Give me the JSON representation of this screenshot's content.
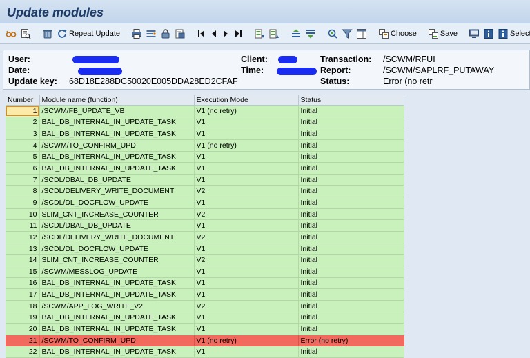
{
  "title": "Update modules",
  "toolbar": {
    "repeat_update_label": "Repeat Update",
    "choose_label": "Choose",
    "save_label": "Save",
    "selections_label": "Selections",
    "icons": [
      "glasses-icon",
      "details-icon",
      "trash-icon",
      "refresh-icon",
      "print-icon",
      "find-icon",
      "lock-icon",
      "export-icon",
      "first-page-icon",
      "previous-page-icon",
      "next-page-icon",
      "last-page-icon",
      "sort-asc-icon",
      "sort-desc-icon",
      "align-icon",
      "filter-icon",
      "sum-icon",
      "columns-icon",
      "copy-icon",
      "select-layout-icon",
      "save-layout-icon",
      "display-icon",
      "info-icon",
      "help-icon"
    ]
  },
  "header": {
    "user_label": "User:",
    "date_label": "Date:",
    "update_key_label": "Update key:",
    "update_key_value": "68D18E288DC50020E005DDA28ED2CFAF",
    "client_label": "Client:",
    "time_label": "Time:",
    "transaction_label": "Transaction:",
    "transaction_value": "/SCWM/RFUI",
    "report_label": "Report:",
    "report_value": "/SCWM/SAPLRF_PUTAWAY",
    "status_label": "Status:",
    "status_value": "Error (no retr"
  },
  "table": {
    "columns": [
      "Number",
      "Module name (function)",
      "Execution Mode",
      "Status"
    ],
    "rows": [
      {
        "number": "1",
        "module": "/SCWM/FB_UPDATE_VB",
        "mode": "V1 (no retry)",
        "status": "Initial",
        "state": "ok"
      },
      {
        "number": "2",
        "module": "BAL_DB_INTERNAL_IN_UPDATE_TASK",
        "mode": "V1",
        "status": "Initial",
        "state": "ok"
      },
      {
        "number": "3",
        "module": "BAL_DB_INTERNAL_IN_UPDATE_TASK",
        "mode": "V1",
        "status": "Initial",
        "state": "ok"
      },
      {
        "number": "4",
        "module": "/SCWM/TO_CONFIRM_UPD",
        "mode": "V1 (no retry)",
        "status": "Initial",
        "state": "ok"
      },
      {
        "number": "5",
        "module": "BAL_DB_INTERNAL_IN_UPDATE_TASK",
        "mode": "V1",
        "status": "Initial",
        "state": "ok"
      },
      {
        "number": "6",
        "module": "BAL_DB_INTERNAL_IN_UPDATE_TASK",
        "mode": "V1",
        "status": "Initial",
        "state": "ok"
      },
      {
        "number": "7",
        "module": "/SCDL/DBAL_DB_UPDATE",
        "mode": "V1",
        "status": "Initial",
        "state": "ok"
      },
      {
        "number": "8",
        "module": "/SCDL/DELIVERY_WRITE_DOCUMENT",
        "mode": "V2",
        "status": "Initial",
        "state": "ok"
      },
      {
        "number": "9",
        "module": "/SCDL/DL_DOCFLOW_UPDATE",
        "mode": "V1",
        "status": "Initial",
        "state": "ok"
      },
      {
        "number": "10",
        "module": "SLIM_CNT_INCREASE_COUNTER",
        "mode": "V2",
        "status": "Initial",
        "state": "ok"
      },
      {
        "number": "11",
        "module": "/SCDL/DBAL_DB_UPDATE",
        "mode": "V1",
        "status": "Initial",
        "state": "ok"
      },
      {
        "number": "12",
        "module": "/SCDL/DELIVERY_WRITE_DOCUMENT",
        "mode": "V2",
        "status": "Initial",
        "state": "ok"
      },
      {
        "number": "13",
        "module": "/SCDL/DL_DOCFLOW_UPDATE",
        "mode": "V1",
        "status": "Initial",
        "state": "ok"
      },
      {
        "number": "14",
        "module": "SLIM_CNT_INCREASE_COUNTER",
        "mode": "V2",
        "status": "Initial",
        "state": "ok"
      },
      {
        "number": "15",
        "module": "/SCWM/MESSLOG_UPDATE",
        "mode": "V1",
        "status": "Initial",
        "state": "ok"
      },
      {
        "number": "16",
        "module": "BAL_DB_INTERNAL_IN_UPDATE_TASK",
        "mode": "V1",
        "status": "Initial",
        "state": "ok"
      },
      {
        "number": "17",
        "module": "BAL_DB_INTERNAL_IN_UPDATE_TASK",
        "mode": "V1",
        "status": "Initial",
        "state": "ok"
      },
      {
        "number": "18",
        "module": "/SCWM/APP_LOG_WRITE_V2",
        "mode": "V2",
        "status": "Initial",
        "state": "ok"
      },
      {
        "number": "19",
        "module": "BAL_DB_INTERNAL_IN_UPDATE_TASK",
        "mode": "V1",
        "status": "Initial",
        "state": "ok"
      },
      {
        "number": "20",
        "module": "BAL_DB_INTERNAL_IN_UPDATE_TASK",
        "mode": "V1",
        "status": "Initial",
        "state": "ok"
      },
      {
        "number": "21",
        "module": "/SCWM/TO_CONFIRM_UPD",
        "mode": "V1 (no retry)",
        "status": "Error (no retry)",
        "state": "err"
      },
      {
        "number": "22",
        "module": "BAL_DB_INTERNAL_IN_UPDATE_TASK",
        "mode": "V1",
        "status": "Initial",
        "state": "ok"
      }
    ]
  },
  "colors": {
    "ok_row": "#c9f1bc",
    "error_row": "#f26a5e",
    "title_text": "#1d3c68",
    "redaction": "#1a2cf0"
  }
}
